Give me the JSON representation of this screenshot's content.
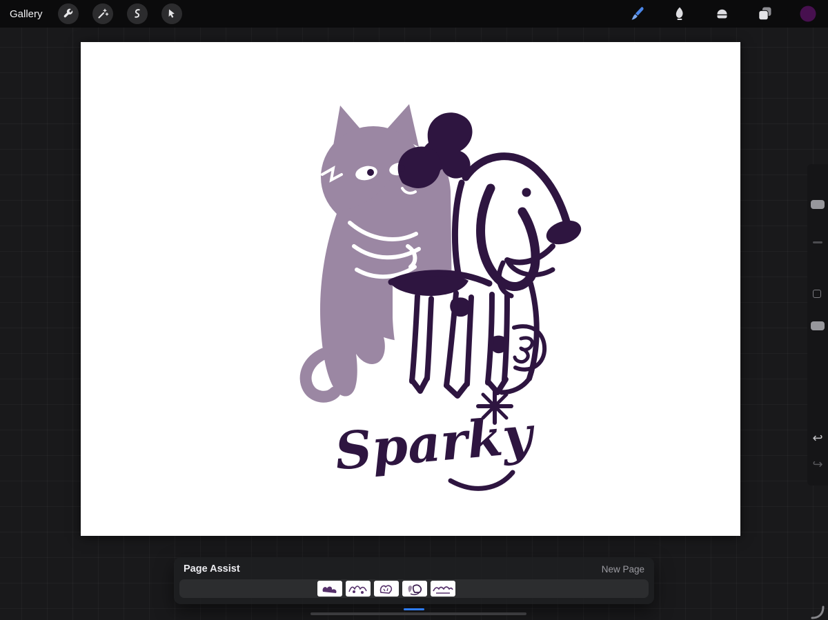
{
  "topbar": {
    "gallery_label": "Gallery",
    "active_tool_color": "#4a86e8",
    "left_tools": [
      {
        "name": "actions",
        "icon": "wrench-icon"
      },
      {
        "name": "adjustments",
        "icon": "magic-wand-icon"
      },
      {
        "name": "selection",
        "icon": "selection-ribbon-icon"
      },
      {
        "name": "transform",
        "icon": "transform-arrow-icon"
      }
    ],
    "right_tools": [
      {
        "name": "paint",
        "icon": "brush-icon",
        "active": true
      },
      {
        "name": "smudge",
        "icon": "smudge-icon",
        "active": false
      },
      {
        "name": "erase",
        "icon": "eraser-icon",
        "active": false
      },
      {
        "name": "layers",
        "icon": "layers-icon",
        "active": false
      },
      {
        "name": "color",
        "icon": "color-swatch-icon",
        "color": "#47104f"
      }
    ]
  },
  "canvas": {
    "background": "#ffffff",
    "artwork": {
      "caption": "Sparky",
      "cat_color": "#9b87a3",
      "ink_color": "#2e1540"
    }
  },
  "sidebar": {
    "controls": [
      {
        "name": "brush-size-slider"
      },
      {
        "name": "modify-button"
      },
      {
        "name": "opacity-slider"
      },
      {
        "name": "undo-button",
        "glyph": "↩"
      },
      {
        "name": "redo-button",
        "glyph": "↪"
      }
    ]
  },
  "page_assist": {
    "title": "Page Assist",
    "new_page_label": "New Page",
    "selected_indicator_color": "#2e7cf6",
    "pages": [
      {
        "name": "page-1",
        "selected": false
      },
      {
        "name": "page-2",
        "selected": false
      },
      {
        "name": "page-3",
        "selected": false
      },
      {
        "name": "page-4",
        "selected": true
      },
      {
        "name": "page-5",
        "selected": false
      }
    ]
  }
}
